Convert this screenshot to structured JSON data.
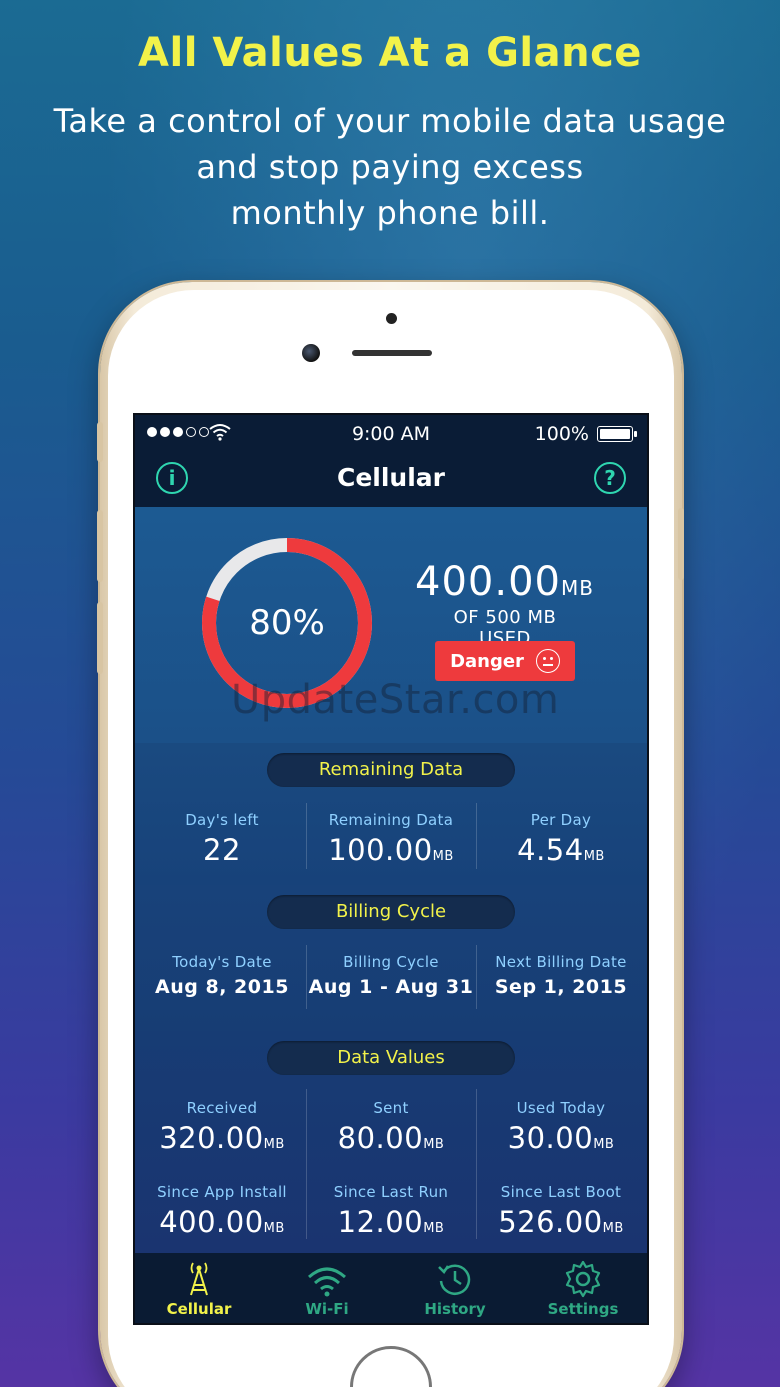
{
  "promo": {
    "headline": "All Values At a Glance",
    "line1": "Take a control of your mobile data usage",
    "line2": "and stop paying excess",
    "line3": "monthly phone bill."
  },
  "status_bar": {
    "time": "9:00 AM",
    "battery": "100%",
    "signal_bars": 3,
    "signal_total": 5
  },
  "nav": {
    "title": "Cellular",
    "info_icon": "info-icon",
    "help_icon": "help-icon",
    "info_glyph": "i",
    "help_glyph": "?"
  },
  "summary": {
    "percent_label": "80%",
    "percent_used": 0.8,
    "used_value": "400.00",
    "used_unit": "MB",
    "used_caption": "OF 500 MB USED",
    "status_label": "Danger",
    "watermark": "UpdateStar.com",
    "colors": {
      "used": "#ee3a3d",
      "remaining": "#e8e8ea",
      "status": "#ee3a3d"
    }
  },
  "remaining": {
    "title": "Remaining Data",
    "items": [
      {
        "label": "Day's left",
        "value": "22",
        "unit": ""
      },
      {
        "label": "Remaining Data",
        "value": "100.00",
        "unit": "MB"
      },
      {
        "label": "Per Day",
        "value": "4.54",
        "unit": "MB"
      }
    ]
  },
  "billing": {
    "title": "Billing Cycle",
    "items": [
      {
        "label": "Today's Date",
        "value": "Aug 8, 2015"
      },
      {
        "label": "Billing Cycle",
        "value": "Aug 1 - Aug 31"
      },
      {
        "label": "Next Billing Date",
        "value": "Sep 1, 2015"
      }
    ]
  },
  "data_values": {
    "title": "Data Values",
    "row1": [
      {
        "label": "Received",
        "value": "320.00",
        "unit": "MB"
      },
      {
        "label": "Sent",
        "value": "80.00",
        "unit": "MB"
      },
      {
        "label": "Used Today",
        "value": "30.00",
        "unit": "MB"
      }
    ],
    "row2": [
      {
        "label": "Since App Install",
        "value": "400.00",
        "unit": "MB"
      },
      {
        "label": "Since Last Run",
        "value": "12.00",
        "unit": "MB"
      },
      {
        "label": "Since Last Boot",
        "value": "526.00",
        "unit": "MB"
      }
    ]
  },
  "tabs": [
    {
      "label": "Cellular",
      "icon": "cell-tower-icon",
      "active": true
    },
    {
      "label": "Wi-Fi",
      "icon": "wifi-icon",
      "active": false
    },
    {
      "label": "History",
      "icon": "history-icon",
      "active": false
    },
    {
      "label": "Settings",
      "icon": "gear-icon",
      "active": false
    }
  ],
  "colors": {
    "accent_yellow": "#f2f24a",
    "accent_teal": "#2fd6b0",
    "label_blue": "#8fd0ff"
  }
}
